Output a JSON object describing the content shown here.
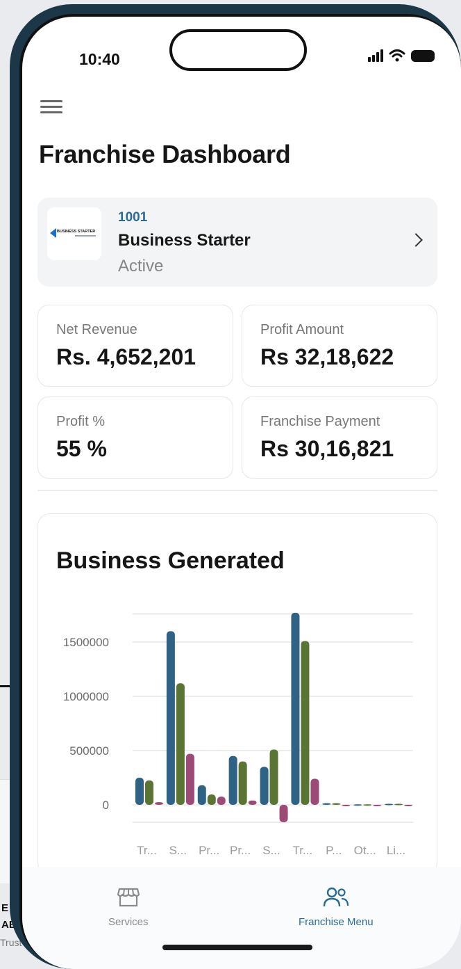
{
  "status_bar": {
    "time": "10:40"
  },
  "header": {
    "title": "Franchise Dashboard"
  },
  "franchise": {
    "code": "1001",
    "name": "Business Starter",
    "status": "Active",
    "logo_text": "BUSINESS STARTER"
  },
  "stats": [
    {
      "label": "Net Revenue",
      "value": "Rs. 4,652,201"
    },
    {
      "label": "Profit Amount",
      "value": "Rs 32,18,622"
    },
    {
      "label": "Profit %",
      "value": "55 %"
    },
    {
      "label": "Franchise Payment",
      "value": "Rs 30,16,821"
    }
  ],
  "chart": {
    "title": "Business Generated"
  },
  "chart_data": {
    "type": "bar",
    "title": "Business Generated",
    "categories": [
      "Tr...",
      "S...",
      "Pr...",
      "Pr...",
      "S...",
      "Tr...",
      "P...",
      "Ot...",
      "Li..."
    ],
    "y_ticks": [
      "1500000",
      "1000000",
      "500000",
      "0"
    ],
    "ylim": [
      -160000,
      1760000
    ],
    "grid": true,
    "legend": "none",
    "colors": [
      "#2e6386",
      "#5a7434",
      "#9c4a76"
    ],
    "series": [
      {
        "values": [
          250000,
          1600000,
          180000,
          450000,
          350000,
          1770000,
          15000,
          5000,
          10000
        ]
      },
      {
        "values": [
          225000,
          1120000,
          95000,
          400000,
          510000,
          1510000,
          15000,
          5000,
          10000
        ]
      },
      {
        "values": [
          25000,
          470000,
          75000,
          40000,
          -160000,
          240000,
          0,
          -5000,
          0
        ]
      }
    ]
  },
  "bottom_nav": {
    "items": [
      {
        "label": "Services",
        "icon": "store-icon",
        "active": false
      },
      {
        "label": "Franchise Menu",
        "icon": "users-icon",
        "active": true
      }
    ]
  },
  "background_page": {
    "line1": "E",
    "line2": "AB",
    "line3": "Trust"
  }
}
